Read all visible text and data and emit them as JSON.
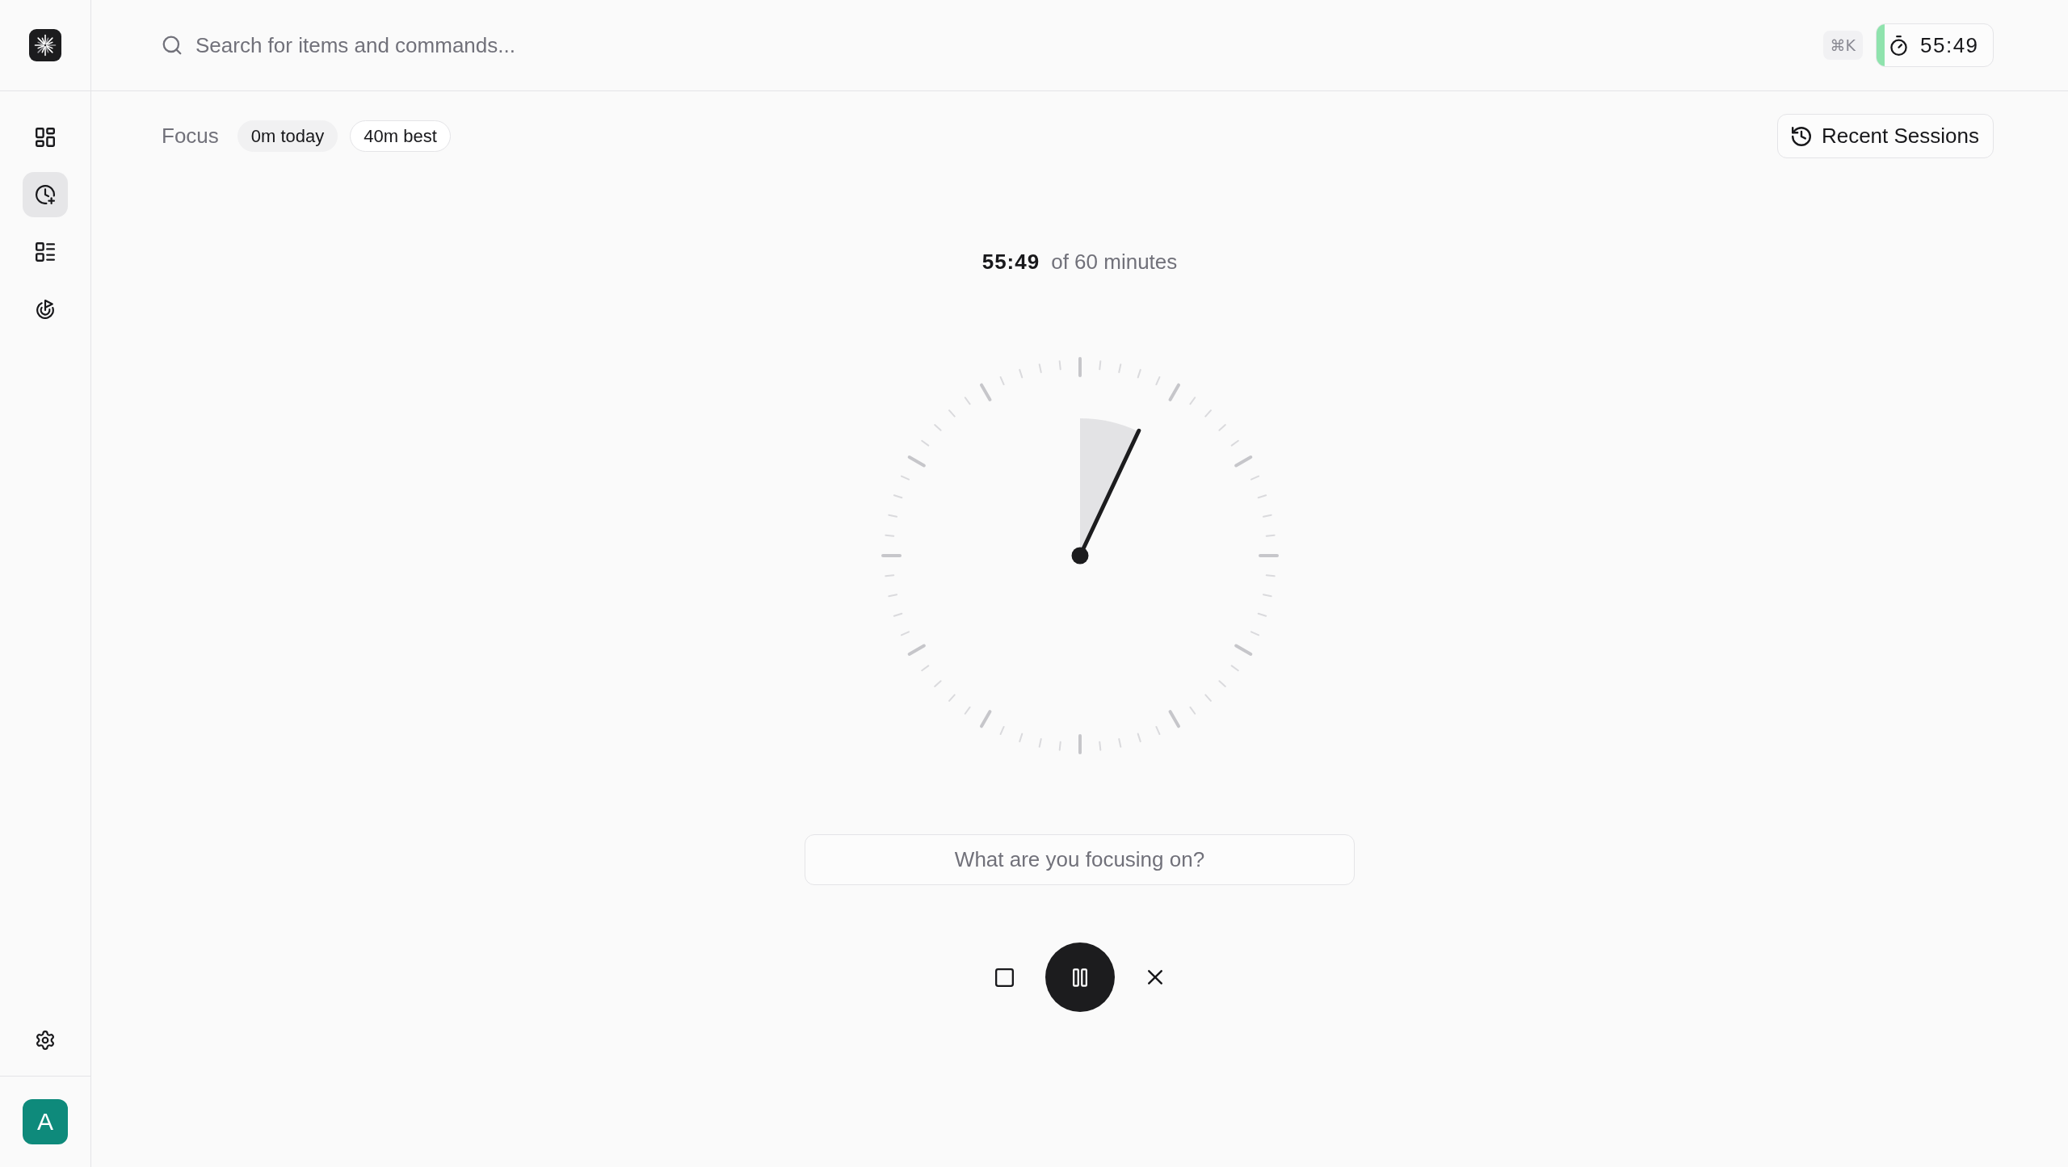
{
  "sidebar": {
    "nav": [
      {
        "selected": false
      },
      {
        "selected": true
      },
      {
        "selected": false
      },
      {
        "selected": false
      }
    ],
    "avatar": {
      "initial": "A"
    }
  },
  "topbar": {
    "search": {
      "placeholder": "Search for items and commands..."
    },
    "shortcut": "⌘K",
    "timer": {
      "time": "55:49"
    }
  },
  "header": {
    "title": "Focus",
    "chips": [
      {
        "text": "0m today",
        "kind": "filled"
      },
      {
        "text": "40m best",
        "kind": "outlined"
      }
    ],
    "recent_button": "Recent Sessions"
  },
  "timer": {
    "remaining": "55:49",
    "total": "of 60 minutes",
    "level": 0.07,
    "running": true,
    "task_input": {
      "placeholder": "What are you focusing on?"
    }
  }
}
